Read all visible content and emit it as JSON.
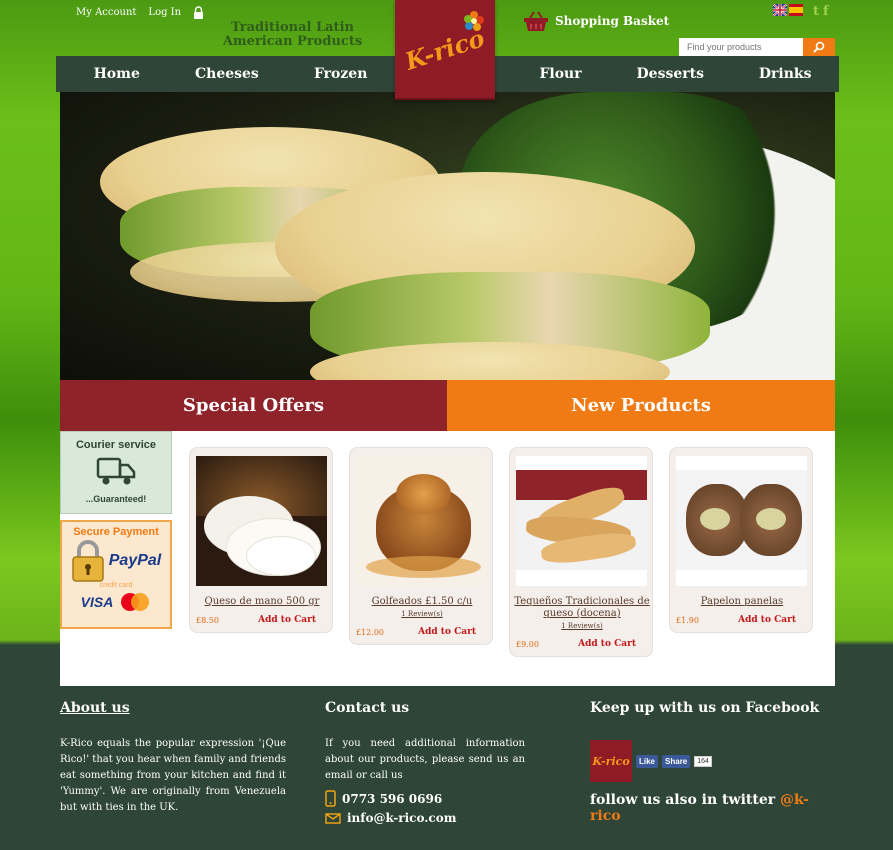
{
  "header": {
    "my_account": "My Account",
    "log_in": "Log In",
    "tagline": "Traditional Latin American Products",
    "logo_text": "K-rico",
    "basket_label": "Shopping Basket",
    "search_placeholder": "Find your products",
    "twitter_glyph": "t",
    "facebook_glyph": "f"
  },
  "nav": {
    "left": [
      "Home",
      "Cheeses",
      "Frozen"
    ],
    "right": [
      "Flour",
      "Desserts",
      "Drinks"
    ]
  },
  "sections": {
    "offers": "Special Offers",
    "new_products": "New Products"
  },
  "side": {
    "courier_title": "Courier service",
    "courier_sub": "...Guaranteed!",
    "secure_title": "Secure Payment",
    "paypal": "PayPal",
    "credit_card": "credit card",
    "visa": "VISA"
  },
  "products": [
    {
      "name": "Queso de mano 500 gr",
      "reviews": "",
      "price": "£8.50",
      "add": "Add to Cart"
    },
    {
      "name": "Golfeados £1.50 c/u",
      "reviews": "1 Review(s)",
      "price": "£12.00",
      "add": "Add to Cart"
    },
    {
      "name": "Tequeños Tradicionales de queso (docena)",
      "reviews": "1 Review(s)",
      "price": "£9.00",
      "add": "Add to Cart"
    },
    {
      "name": "Papelon panelas",
      "reviews": "",
      "price": "£1.90",
      "add": "Add to Cart"
    }
  ],
  "footer": {
    "about_title": "About us",
    "about_text": "K-Rico equals the popular expression '¡Que Rico!' that you hear when family and friends eat something from your kitchen and find it 'Yummy'. We are originally from Venezuela but with ties in the UK.",
    "contact_title": "Contact us",
    "contact_text": "If you need additional information about our products, please send us an email or call us",
    "phone": "0773 596 0696",
    "email": "info@k-rico.com",
    "facebook_title": "Keep up with us on Facebook",
    "fb_logo": "K-rico",
    "fb_like": "Like",
    "fb_share": "Share",
    "fb_count": "164",
    "twitter_text": "follow us also in twitter",
    "twitter_handle": "@k-rico"
  },
  "colors": {
    "brand_red": "#8e1b25",
    "brand_orange": "#f07b14",
    "nav_dark": "#2f4538"
  }
}
